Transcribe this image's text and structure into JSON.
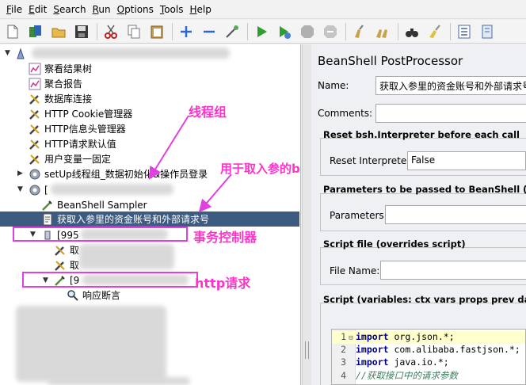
{
  "menubar": {
    "items": [
      {
        "label": "File",
        "mnemonic": "F",
        "rest": "ile"
      },
      {
        "label": "Edit",
        "mnemonic": "E",
        "rest": "dit"
      },
      {
        "label": "Search",
        "mnemonic": "S",
        "rest": "earch"
      },
      {
        "label": "Run",
        "mnemonic": "R",
        "rest": "un"
      },
      {
        "label": "Options",
        "mnemonic": "O",
        "rest": "ptions"
      },
      {
        "label": "Tools",
        "mnemonic": "T",
        "rest": "ools"
      },
      {
        "label": "Help",
        "mnemonic": "H",
        "rest": "elp"
      }
    ]
  },
  "tree": {
    "nodes": [
      {
        "label": "察看结果树"
      },
      {
        "label": "聚合报告"
      },
      {
        "label": "数据库连接"
      },
      {
        "label": "HTTP Cookie管理器"
      },
      {
        "label": "HTTP信息头管理器"
      },
      {
        "label": "HTTP请求默认值"
      },
      {
        "label": "用户变量一固定"
      },
      {
        "label": "setUp线程组_数据初始化&操作员登录"
      },
      {
        "label": "["
      },
      {
        "label": "BeanShell Sampler"
      },
      {
        "label": "获取入参里的资金账号和外部请求号"
      },
      {
        "label": "[995"
      },
      {
        "label": "取"
      },
      {
        "label": "取"
      },
      {
        "label": "[9"
      },
      {
        "label": "响应断言"
      }
    ]
  },
  "annotations": {
    "thread_group": "线程组",
    "beanshell": "用于取入参的beanshell",
    "transaction": "事务控制器",
    "http": "http请求"
  },
  "panel": {
    "title": "BeanShell PostProcessor",
    "name_label": "Name:",
    "name_value": "获取入参里的资金账号和外部请求号",
    "comments_label": "Comments:",
    "reset_section": "Reset bsh.Interpreter before each call",
    "reset_label": "Reset Interpreter:",
    "reset_value": "False",
    "params_section": "Parameters to be passed to BeanShell (=> St",
    "params_label": "Parameters:",
    "file_section": "Script file (overrides script)",
    "file_label": "File Name:",
    "script_section": "Script (variables: ctx vars props prev data log"
  },
  "script": {
    "lines": [
      {
        "num": "1",
        "kw": "import",
        "text": " org.json.*;"
      },
      {
        "num": "2",
        "kw": "import",
        "text": " com.alibaba.fastjson.*;"
      },
      {
        "num": "3",
        "kw": "import",
        "text": " java.io.*;"
      },
      {
        "num": "4",
        "kw": "",
        "text": "//获取接口中的请求参数"
      }
    ]
  },
  "colors": {
    "accent_selection": "#3d5a80",
    "annotation": "#ff33cc",
    "annotation_box": "#e040e0"
  }
}
